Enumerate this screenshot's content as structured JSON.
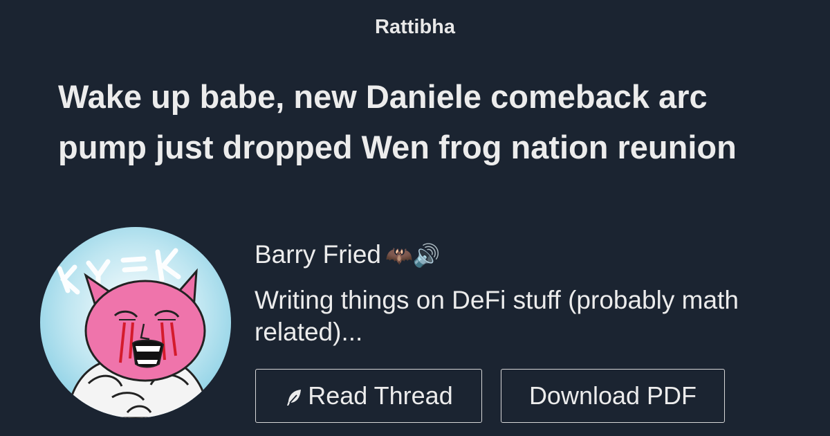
{
  "header": {
    "brand": "Rattibha"
  },
  "thread": {
    "title": "Wake up babe, new Daniele comeback arc pump just dropped Wen frog nation reunion"
  },
  "author": {
    "name": "Barry Fried",
    "name_emoji": "🦇🔊",
    "bio": "Writing things on DeFi stuff (probably math related)...",
    "avatar_icon": "avatar-image"
  },
  "actions": {
    "read_label": "Read Thread",
    "read_icon": "feather-icon",
    "pdf_label": "Download PDF"
  },
  "colors": {
    "background": "#1b2431",
    "text": "#ececec",
    "button_border": "#d8d8d8"
  }
}
